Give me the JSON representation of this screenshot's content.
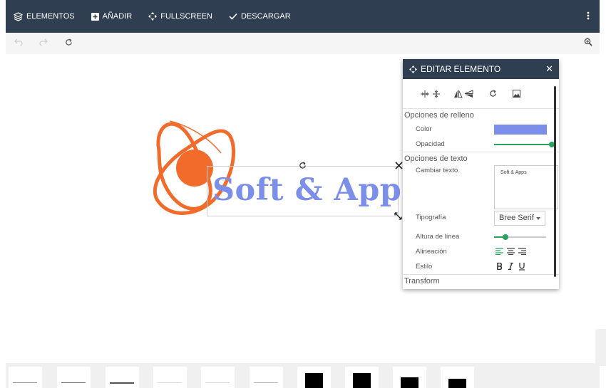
{
  "topbar": {
    "items": [
      {
        "label": "ELEMENTOS",
        "icon": "layers-icon"
      },
      {
        "label": "AÑADIR",
        "icon": "plus-box-icon"
      },
      {
        "label": "FULLSCREEN",
        "icon": "arrows-expand-icon"
      },
      {
        "label": "DESCARGAR",
        "icon": "check-icon"
      }
    ],
    "more_icon": "more-vertical-icon"
  },
  "subbar": {
    "icons": [
      "undo-icon",
      "redo-icon",
      "refresh-icon",
      "zoom-in-icon"
    ]
  },
  "canvas": {
    "logo_text": "Soft & Apps",
    "brand_orange": "#f26b2a",
    "brand_blue": "#7b8ee9"
  },
  "panel": {
    "title": "EDITAR ELEMENTO",
    "close": "✕",
    "fill_section": "Opciones de relleno",
    "color_label": "Color",
    "color_value": "#7b8ee9",
    "opacity_label": "Opacidad",
    "opacity_value": 1.0,
    "text_section": "Opciones de texto",
    "change_text_label": "Cambiar texto",
    "text_value": "Soft & Apps",
    "font_label": "Tipografía",
    "font_value": "Bree Serif",
    "line_height_label": "Altura de línea",
    "line_height_value": 0.2,
    "align_label": "Alineación",
    "style_label": "Estilo",
    "transform_section": "Transform",
    "accent": "#27a35c"
  }
}
